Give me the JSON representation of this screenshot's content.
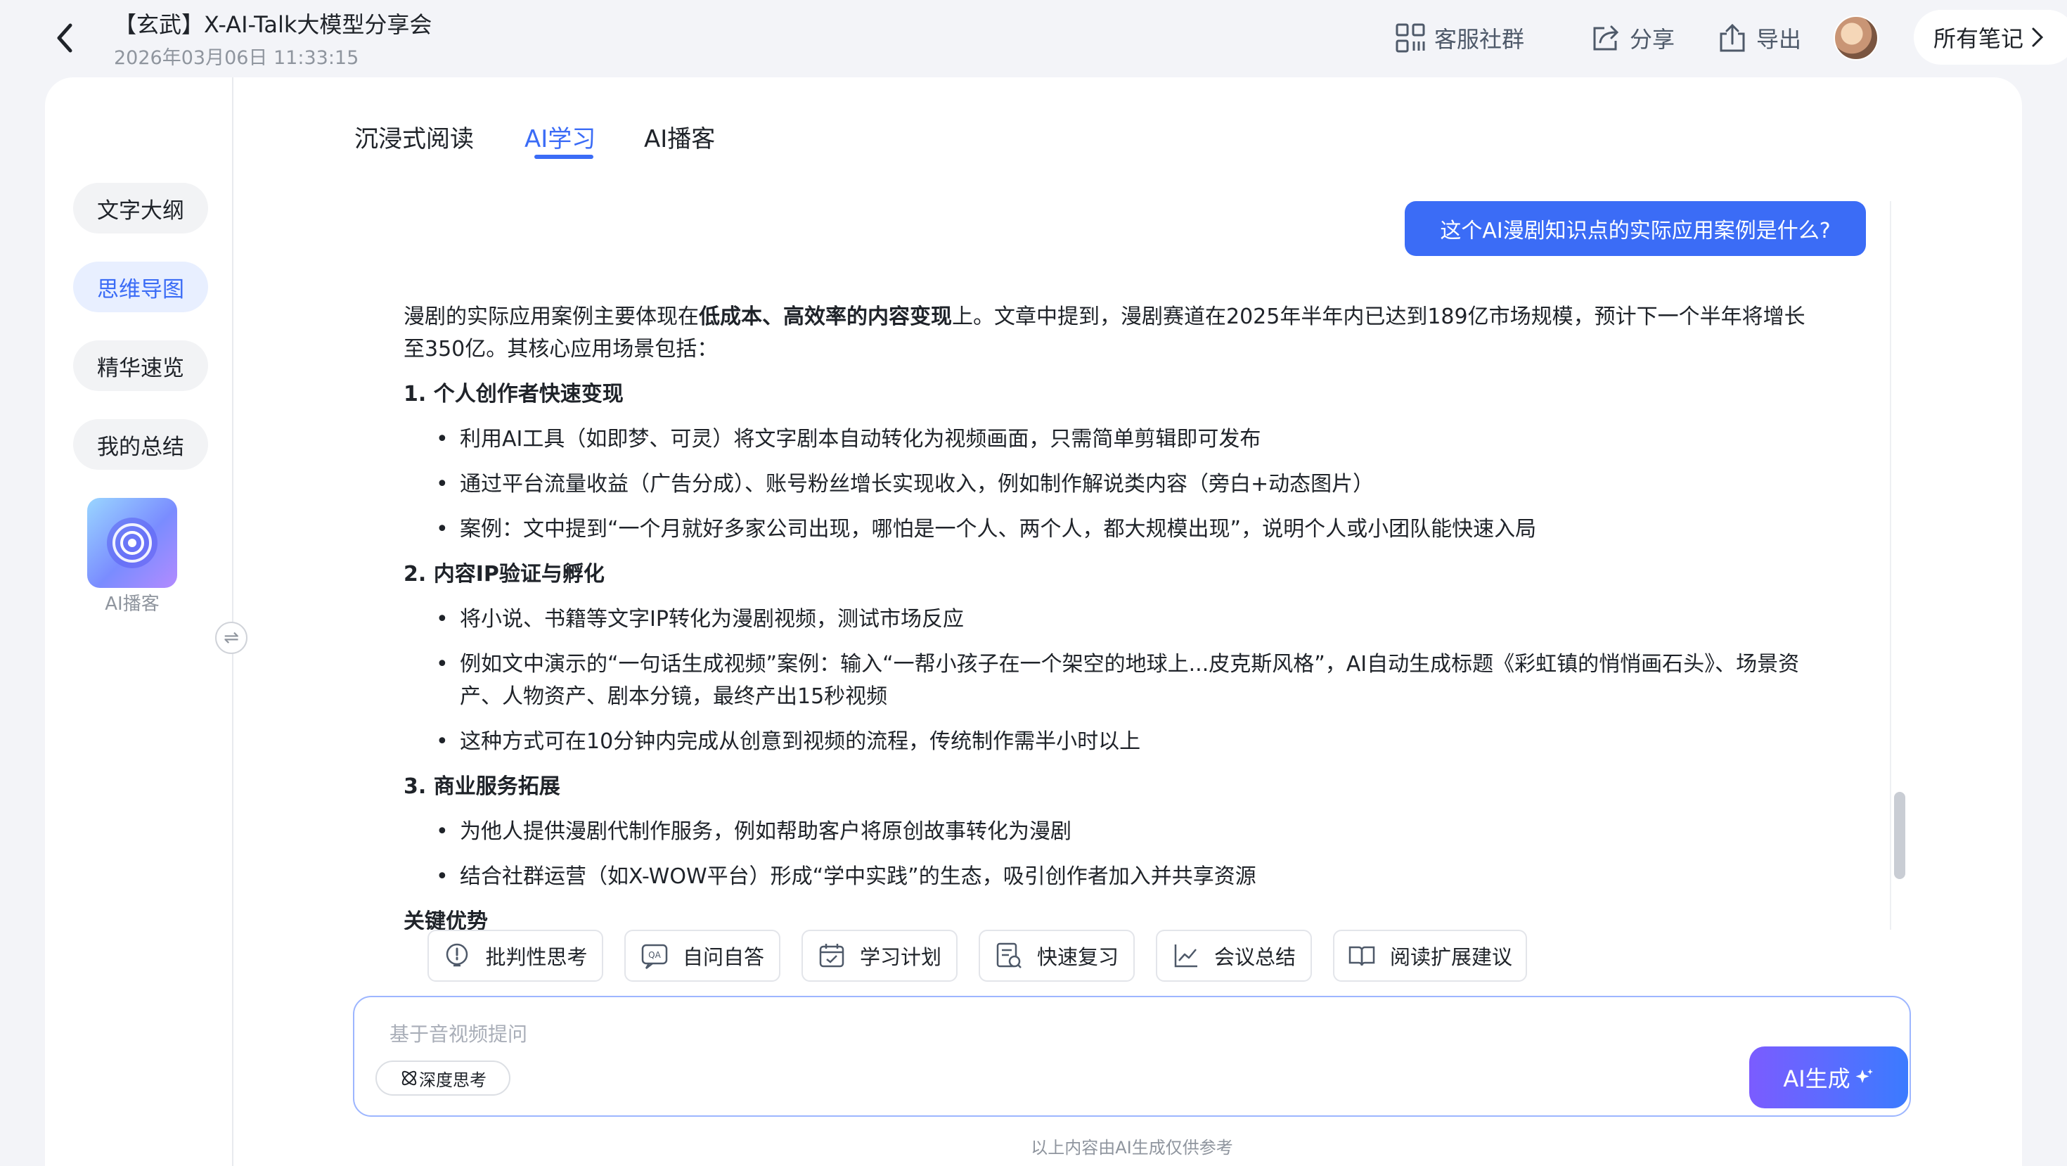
{
  "header": {
    "back_icon": "chevron-left-icon",
    "title": "【玄武】X-AI-Talk大模型分享会",
    "timestamp": "2026年03月06日 11:33:15",
    "actions": [
      {
        "label": "客服社群",
        "icon": "qr-grid-icon"
      },
      {
        "label": "分享",
        "icon": "share-icon"
      },
      {
        "label": "导出",
        "icon": "export-icon"
      }
    ],
    "all_notes": "所有笔记",
    "all_notes_chevron": ">"
  },
  "sidebar": {
    "items": [
      {
        "label": "文字大纲",
        "active": false
      },
      {
        "label": "思维导图",
        "active": true
      },
      {
        "label": "精华速览",
        "active": false
      },
      {
        "label": "我的总结",
        "active": false
      }
    ],
    "podcast_label": "AI播客",
    "swap_glyph": "⇌"
  },
  "tabs": [
    {
      "label": "沉浸式阅读",
      "active": false
    },
    {
      "label": "AI学习",
      "active": true
    },
    {
      "label": "AI播客",
      "active": false
    }
  ],
  "chat": {
    "question": "这个AI漫剧知识点的实际应用案例是什么?",
    "answer": {
      "intro_1": "漫剧的实际应用案例主要体现在",
      "intro_bold": "低成本、高效率的内容变现",
      "intro_2": "上。文章中提到，漫剧赛道在2025年半年内已达到189亿市场规模，预计下一个半年将增长至350亿。其核心应用场景包括：",
      "sections": [
        {
          "heading": "1. 个人创作者快速变现",
          "bullets": [
            "利用AI工具（如即梦、可灵）将文字剧本自动转化为视频画面，只需简单剪辑即可发布",
            "通过平台流量收益（广告分成）、账号粉丝增长实现收入，例如制作解说类内容（旁白+动态图片）",
            "案例：文中提到“一个月就好多家公司出现，哪怕是一个人、两个人，都大规模出现”，说明个人或小团队能快速入局"
          ]
        },
        {
          "heading": "2. 内容IP验证与孵化",
          "bullets": [
            "将小说、书籍等文字IP转化为漫剧视频，测试市场反应",
            "例如文中演示的“一句话生成视频”案例：输入“一帮小孩子在一个架空的地球上...皮克斯风格”，AI自动生成标题《彩虹镇的悄悄画石头》、场景资产、人物资产、剧本分镜，最终产出15秒视频",
            "这种方式可在10分钟内完成从创意到视频的流程，传统制作需半小时以上"
          ]
        },
        {
          "heading": "3. 商业服务拓展",
          "bullets": [
            "为他人提供漫剧代制作服务，例如帮助客户将原创故事转化为漫剧",
            "结合社群运营（如X-WOW平台）形成“学中实践”的生态，吸引创作者加入并共享资源"
          ]
        }
      ],
      "truncated_heading": "关键优势"
    }
  },
  "quick_actions": [
    {
      "label": "批判性思考",
      "icon": "lightbulb-icon"
    },
    {
      "label": "自问自答",
      "icon": "qa-icon"
    },
    {
      "label": "学习计划",
      "icon": "calendar-check-icon"
    },
    {
      "label": "快速复习",
      "icon": "review-doc-icon"
    },
    {
      "label": "会议总结",
      "icon": "line-chart-icon"
    },
    {
      "label": "阅读扩展建议",
      "icon": "book-icon"
    }
  ],
  "input": {
    "placeholder": "基于音视频提问",
    "value": "",
    "deep_think_label": "深度思考",
    "generate_label": "AI生成"
  },
  "disclaimer": "以上内容由AI生成仅供参考",
  "colors": {
    "accent": "#3b6cf6",
    "background": "#f3f4f8",
    "generate_gradient_start": "#7b5cff",
    "generate_gradient_end": "#3b7bff"
  }
}
